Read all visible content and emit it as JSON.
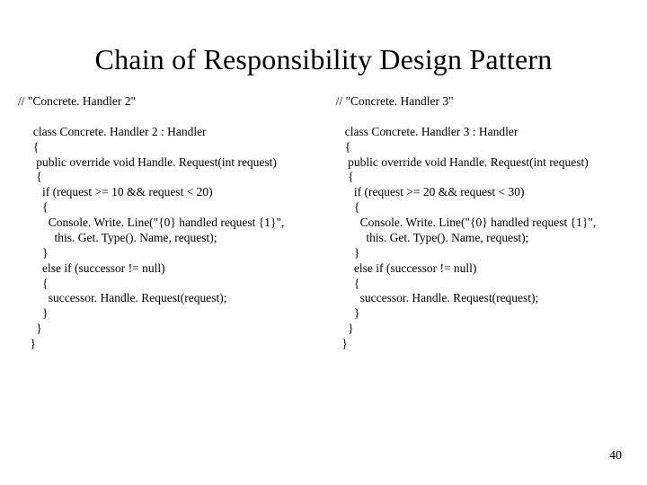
{
  "title": "Chain of Responsibility Design Pattern",
  "left": {
    "comment": "// \"Concrete. Handler 2\"",
    "code": "     class Concrete. Handler 2 : Handler\n     {\n      public override void Handle. Request(int request)\n      {\n        if (request >= 10 && request < 20)\n        {\n          Console. Write. Line(\"{0} handled request {1}\",\n            this. Get. Type(). Name, request);\n        }\n        else if (successor != null)\n        {\n          successor. Handle. Request(request);\n        }\n      }\n    }"
  },
  "right": {
    "comment": "// \"Concrete. Handler 3\"",
    "code": "   class Concrete. Handler 3 : Handler\n   {\n    public override void Handle. Request(int request)\n    {\n      if (request >= 20 && request < 30)\n      {\n        Console. Write. Line(\"{0} handled request {1}\",\n          this. Get. Type(). Name, request);\n      }\n      else if (successor != null)\n      {\n        successor. Handle. Request(request);\n      }\n    }\n  }"
  },
  "page_number": "40"
}
